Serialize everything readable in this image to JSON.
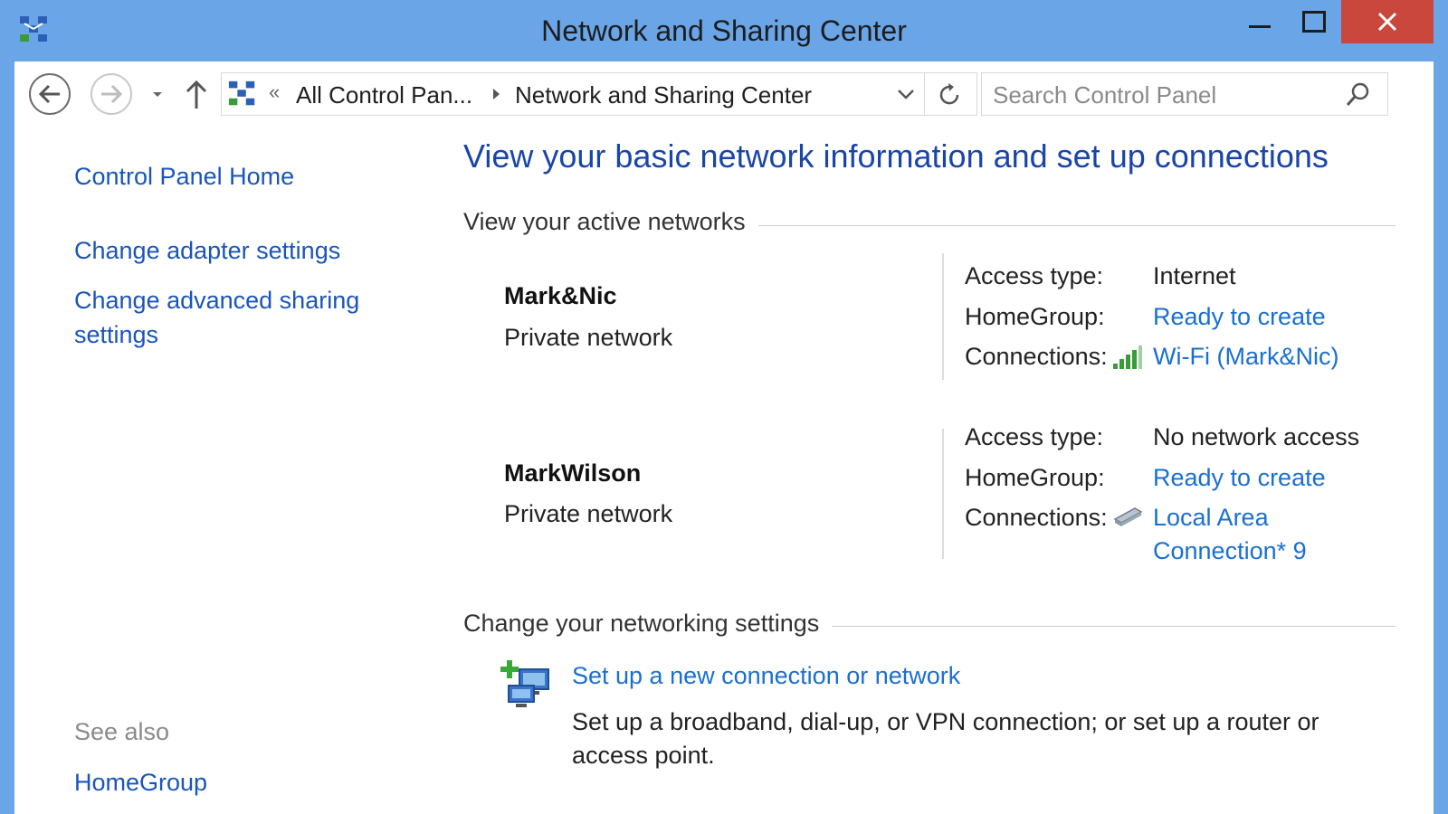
{
  "window": {
    "title": "Network and Sharing Center"
  },
  "navigation": {
    "breadcrumb": [
      "All Control Pan...",
      "Network and Sharing Center"
    ],
    "overflow_marker": "«",
    "search_placeholder": "Search Control Panel"
  },
  "sidebar": {
    "home": "Control Panel Home",
    "items": [
      "Change adapter settings",
      "Change advanced sharing settings"
    ],
    "see_also_label": "See also",
    "see_also_items": [
      "HomeGroup"
    ]
  },
  "main": {
    "heading": "View your basic network information and set up connections",
    "active_networks_label": "View your active networks",
    "networks": [
      {
        "name": "Mark&Nic",
        "category": "Private network",
        "access_type_label": "Access type:",
        "access_type": "Internet",
        "homegroup_label": "HomeGroup:",
        "homegroup": "Ready to create",
        "connections_label": "Connections:",
        "connection": "Wi-Fi (Mark&Nic)",
        "connection_icon": "wifi-signal-icon"
      },
      {
        "name": "MarkWilson",
        "category": "Private network",
        "access_type_label": "Access type:",
        "access_type": "No network access",
        "homegroup_label": "HomeGroup:",
        "homegroup": "Ready to create",
        "connections_label": "Connections:",
        "connection_line1": "Local Area",
        "connection_line2": "Connection* 9",
        "connection_icon": "network-adapter-icon"
      }
    ],
    "change_settings_label": "Change your networking settings",
    "tasks": [
      {
        "title": "Set up a new connection or network",
        "description": "Set up a broadband, dial-up, or VPN connection; or set up a router or access point.",
        "icon": "new-connection-icon"
      }
    ]
  },
  "colors": {
    "title_bar": "#6aa5e8",
    "close_button": "#c9473c",
    "heading": "#1a45a8",
    "link": "#1a6fd1",
    "sidebar_link": "#1a55bb"
  }
}
